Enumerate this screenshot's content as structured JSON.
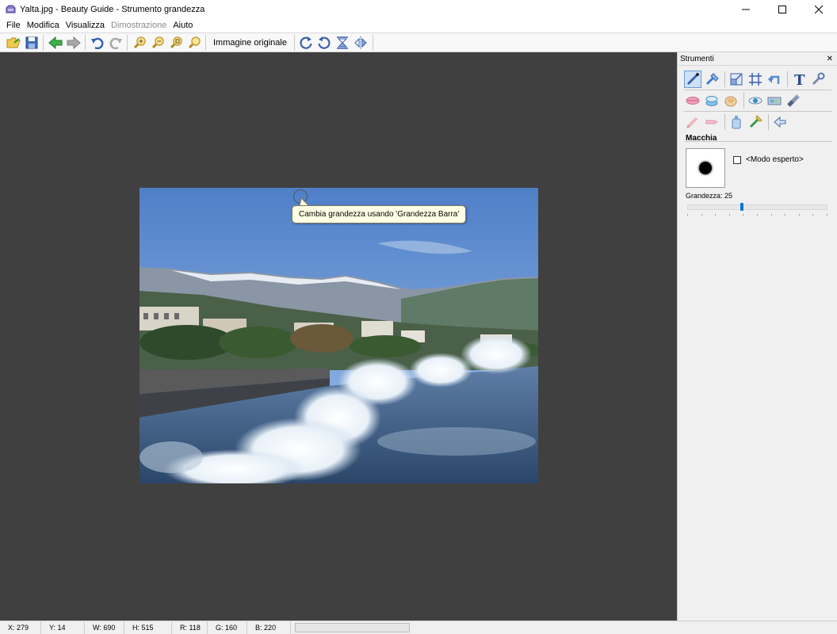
{
  "window": {
    "title": "Yalta.jpg - Beauty Guide - Strumento grandezza",
    "icon": "app-icon",
    "controls": [
      "minimize-icon",
      "maximize-icon",
      "close-icon"
    ]
  },
  "menu": {
    "items": [
      {
        "label": "File",
        "enabled": true
      },
      {
        "label": "Modifica",
        "enabled": true
      },
      {
        "label": "Visualizza",
        "enabled": true
      },
      {
        "label": "Dimostrazione",
        "enabled": false
      },
      {
        "label": "Aiuto",
        "enabled": true
      }
    ]
  },
  "toolbar": {
    "original_image_label": "Immagine originale",
    "buttons": [
      "open-icon",
      "save-icon",
      "back-icon",
      "forward-icon",
      "undo-icon",
      "redo-icon",
      "zoom-in-icon",
      "zoom-out-icon",
      "zoom-fit-icon",
      "zoom-actual-icon",
      "rotate-right-icon",
      "rotate-left-icon",
      "flip-vertical-icon",
      "flip-horizontal-icon"
    ]
  },
  "canvas": {
    "tooltip": "Cambia grandezza usando 'Grandezza Barra'"
  },
  "panel": {
    "title": "Strumenti",
    "section_title": "Macchia",
    "expert_mode_label": "<Modo esperto>",
    "expert_mode_checked": false,
    "size_label": "Grandezza: 25",
    "size_slider_fraction": 0.39
  },
  "status": {
    "x": "X: 279",
    "y": "Y: 14",
    "w": "W: 690",
    "h": "H: 515",
    "r": "R: 118",
    "g": "G: 160",
    "b": "B: 220"
  },
  "colors": {
    "canvas_bg": "#404040",
    "accent": "#0078d7",
    "tooltip_bg": "#ffffe6"
  }
}
